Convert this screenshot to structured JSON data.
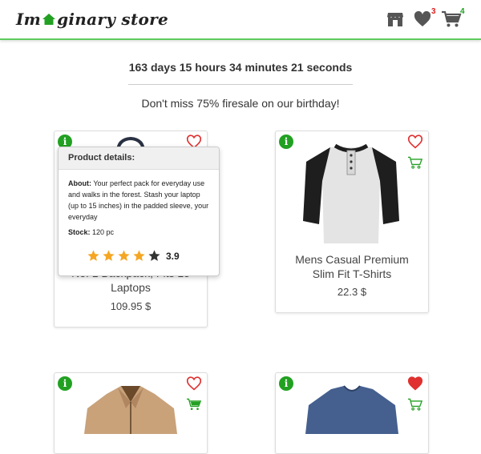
{
  "header": {
    "logo_prefix": "Im",
    "logo_suffix": "ginary store",
    "favorites_count": "3",
    "cart_count": "4",
    "icons": [
      "store-icon",
      "heart-icon",
      "cart-icon"
    ]
  },
  "banner": {
    "countdown": "163 days 15 hours 34 minutes 21 seconds",
    "promo": "Don't miss 75% firesale on our birthday!"
  },
  "tooltip": {
    "title": "Product details:",
    "about_label": "About:",
    "about_text": " Your perfect pack for everyday use and walks in the forest. Stash your laptop (up to 15 inches) in the padded sleeve, your everyday",
    "stock_label": "Stock:",
    "stock_value": " 120 pc",
    "rating": 3.9,
    "rating_text": "3.9"
  },
  "products": [
    {
      "name_line1": "No. 1 Backpack, Fits 15",
      "name_line2": "Laptops",
      "price": "109.95 $",
      "favorited": false
    },
    {
      "name_line1": "Mens Casual Premium",
      "name_line2": "Slim Fit T-Shirts",
      "price": "22.3 $",
      "favorited": false
    },
    {
      "name_line1": "",
      "name_line2": "",
      "price": "",
      "favorited": false
    },
    {
      "name_line1": "",
      "name_line2": "",
      "price": "",
      "favorited": true
    }
  ],
  "colors": {
    "accent_green": "#22a022",
    "heart_red": "#e03030",
    "badge_red": "#dd2222",
    "badge_green": "#1aa31a",
    "star_gold": "#f5a623"
  }
}
